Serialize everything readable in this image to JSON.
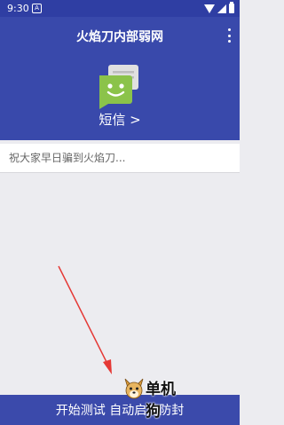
{
  "status_bar": {
    "time": "9:30",
    "notification_icon": "A",
    "icons": [
      "wifi-icon",
      "signal-icon",
      "battery-icon"
    ]
  },
  "app_bar": {
    "title": "火焰刀内部弱网",
    "menu_icon": "more-vert-icon",
    "sms_icon": "sms-chat-icon",
    "sms_label": "短信 >"
  },
  "message_input": {
    "placeholder": "祝大家早日骗到火焰刀..."
  },
  "annotation": {
    "arrow_color": "#e53935"
  },
  "watermark": {
    "text": "单机狗",
    "icon": "dog-mascot-icon"
  },
  "action_button": {
    "label": "开始测试 自动启用防封"
  },
  "colors": {
    "primary": "#3949ab",
    "status_bar": "#2f3ea3",
    "sms_icon_green": "#8bc34a",
    "background": "#ececf0"
  }
}
